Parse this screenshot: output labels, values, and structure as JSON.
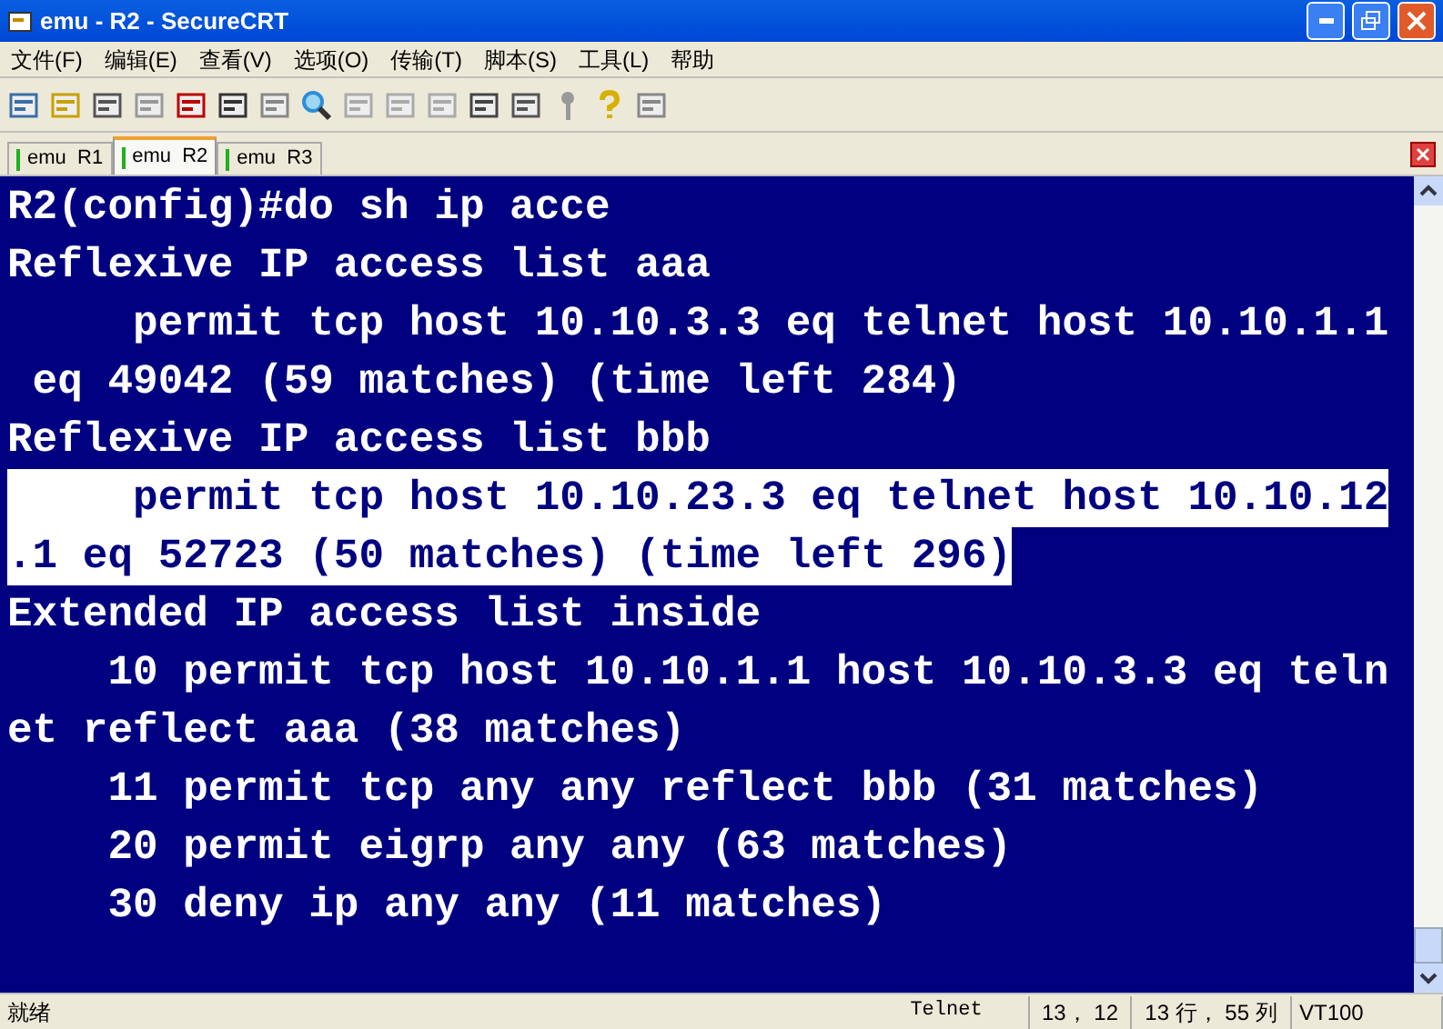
{
  "window": {
    "title": "emu - R2 - SecureCRT"
  },
  "menu": [
    "文件(F)",
    "编辑(E)",
    "查看(V)",
    "选项(O)",
    "传输(T)",
    "脚本(S)",
    "工具(L)",
    "帮助"
  ],
  "tabs": [
    {
      "label": "emu  R1",
      "selected": false
    },
    {
      "label": "emu  R2",
      "selected": true
    },
    {
      "label": "emu  R3",
      "selected": false
    }
  ],
  "terminal": {
    "lines": [
      {
        "text": "R2(config)#do sh ip acce",
        "selected": false
      },
      {
        "text": "Reflexive IP access list aaa",
        "selected": false
      },
      {
        "text": "     permit tcp host 10.10.3.3 eq telnet host 10.10.1.1",
        "selected": false
      },
      {
        "text": " eq 49042 (59 matches) (time left 284)",
        "selected": false
      },
      {
        "text": "Reflexive IP access list bbb",
        "selected": false
      },
      {
        "text": "     permit tcp host 10.10.23.3 eq telnet host 10.10.12",
        "selected": true
      },
      {
        "text": ".1 eq 52723 (50 matches) (time left 296)",
        "selected": true
      },
      {
        "text": "Extended IP access list inside",
        "selected": false
      },
      {
        "text": "    10 permit tcp host 10.10.1.1 host 10.10.3.3 eq teln",
        "selected": false
      },
      {
        "text": "et reflect aaa (38 matches)",
        "selected": false
      },
      {
        "text": "    11 permit tcp any any reflect bbb (31 matches)",
        "selected": false
      },
      {
        "text": "    20 permit eigrp any any (63 matches)",
        "selected": false
      },
      {
        "text": "    30 deny ip any any (11 matches)",
        "selected": false
      }
    ]
  },
  "status_bar": [
    "就绪",
    "Telnet",
    "13， 12",
    "13 行， 55 列",
    "VT100"
  ]
}
